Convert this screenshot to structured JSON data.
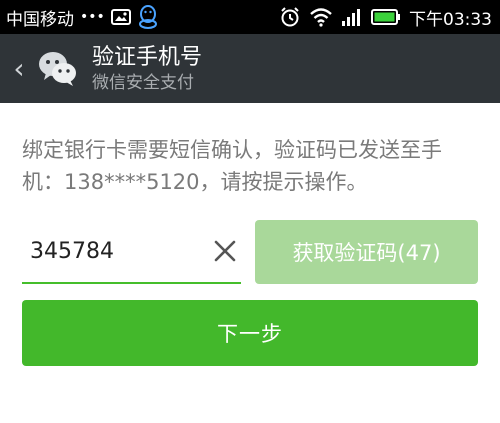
{
  "status_bar": {
    "carrier": "中国移动",
    "dots": "•••",
    "time": "下午03:33",
    "icons": [
      "image-icon",
      "qq-icon",
      "alarm-icon",
      "wifi-icon",
      "signal-icon",
      "battery-icon"
    ]
  },
  "header": {
    "back_glyph": "‹",
    "title": "验证手机号",
    "subtitle": "微信安全支付"
  },
  "notice": {
    "text": "绑定银行卡需要短信确认，验证码已发送至手机：138****5120，请按提示操作。"
  },
  "code_input": {
    "value": "345784",
    "placeholder": ""
  },
  "get_code_button": {
    "label": "获取验证码(47)",
    "countdown": 47
  },
  "next_button": {
    "label": "下一步"
  },
  "colors": {
    "status_bg": "#000000",
    "header_bg": "#2f3438",
    "accent_green": "#43b82b",
    "disabled_green": "#a9d89a",
    "text_gray": "#7a7a7a"
  }
}
